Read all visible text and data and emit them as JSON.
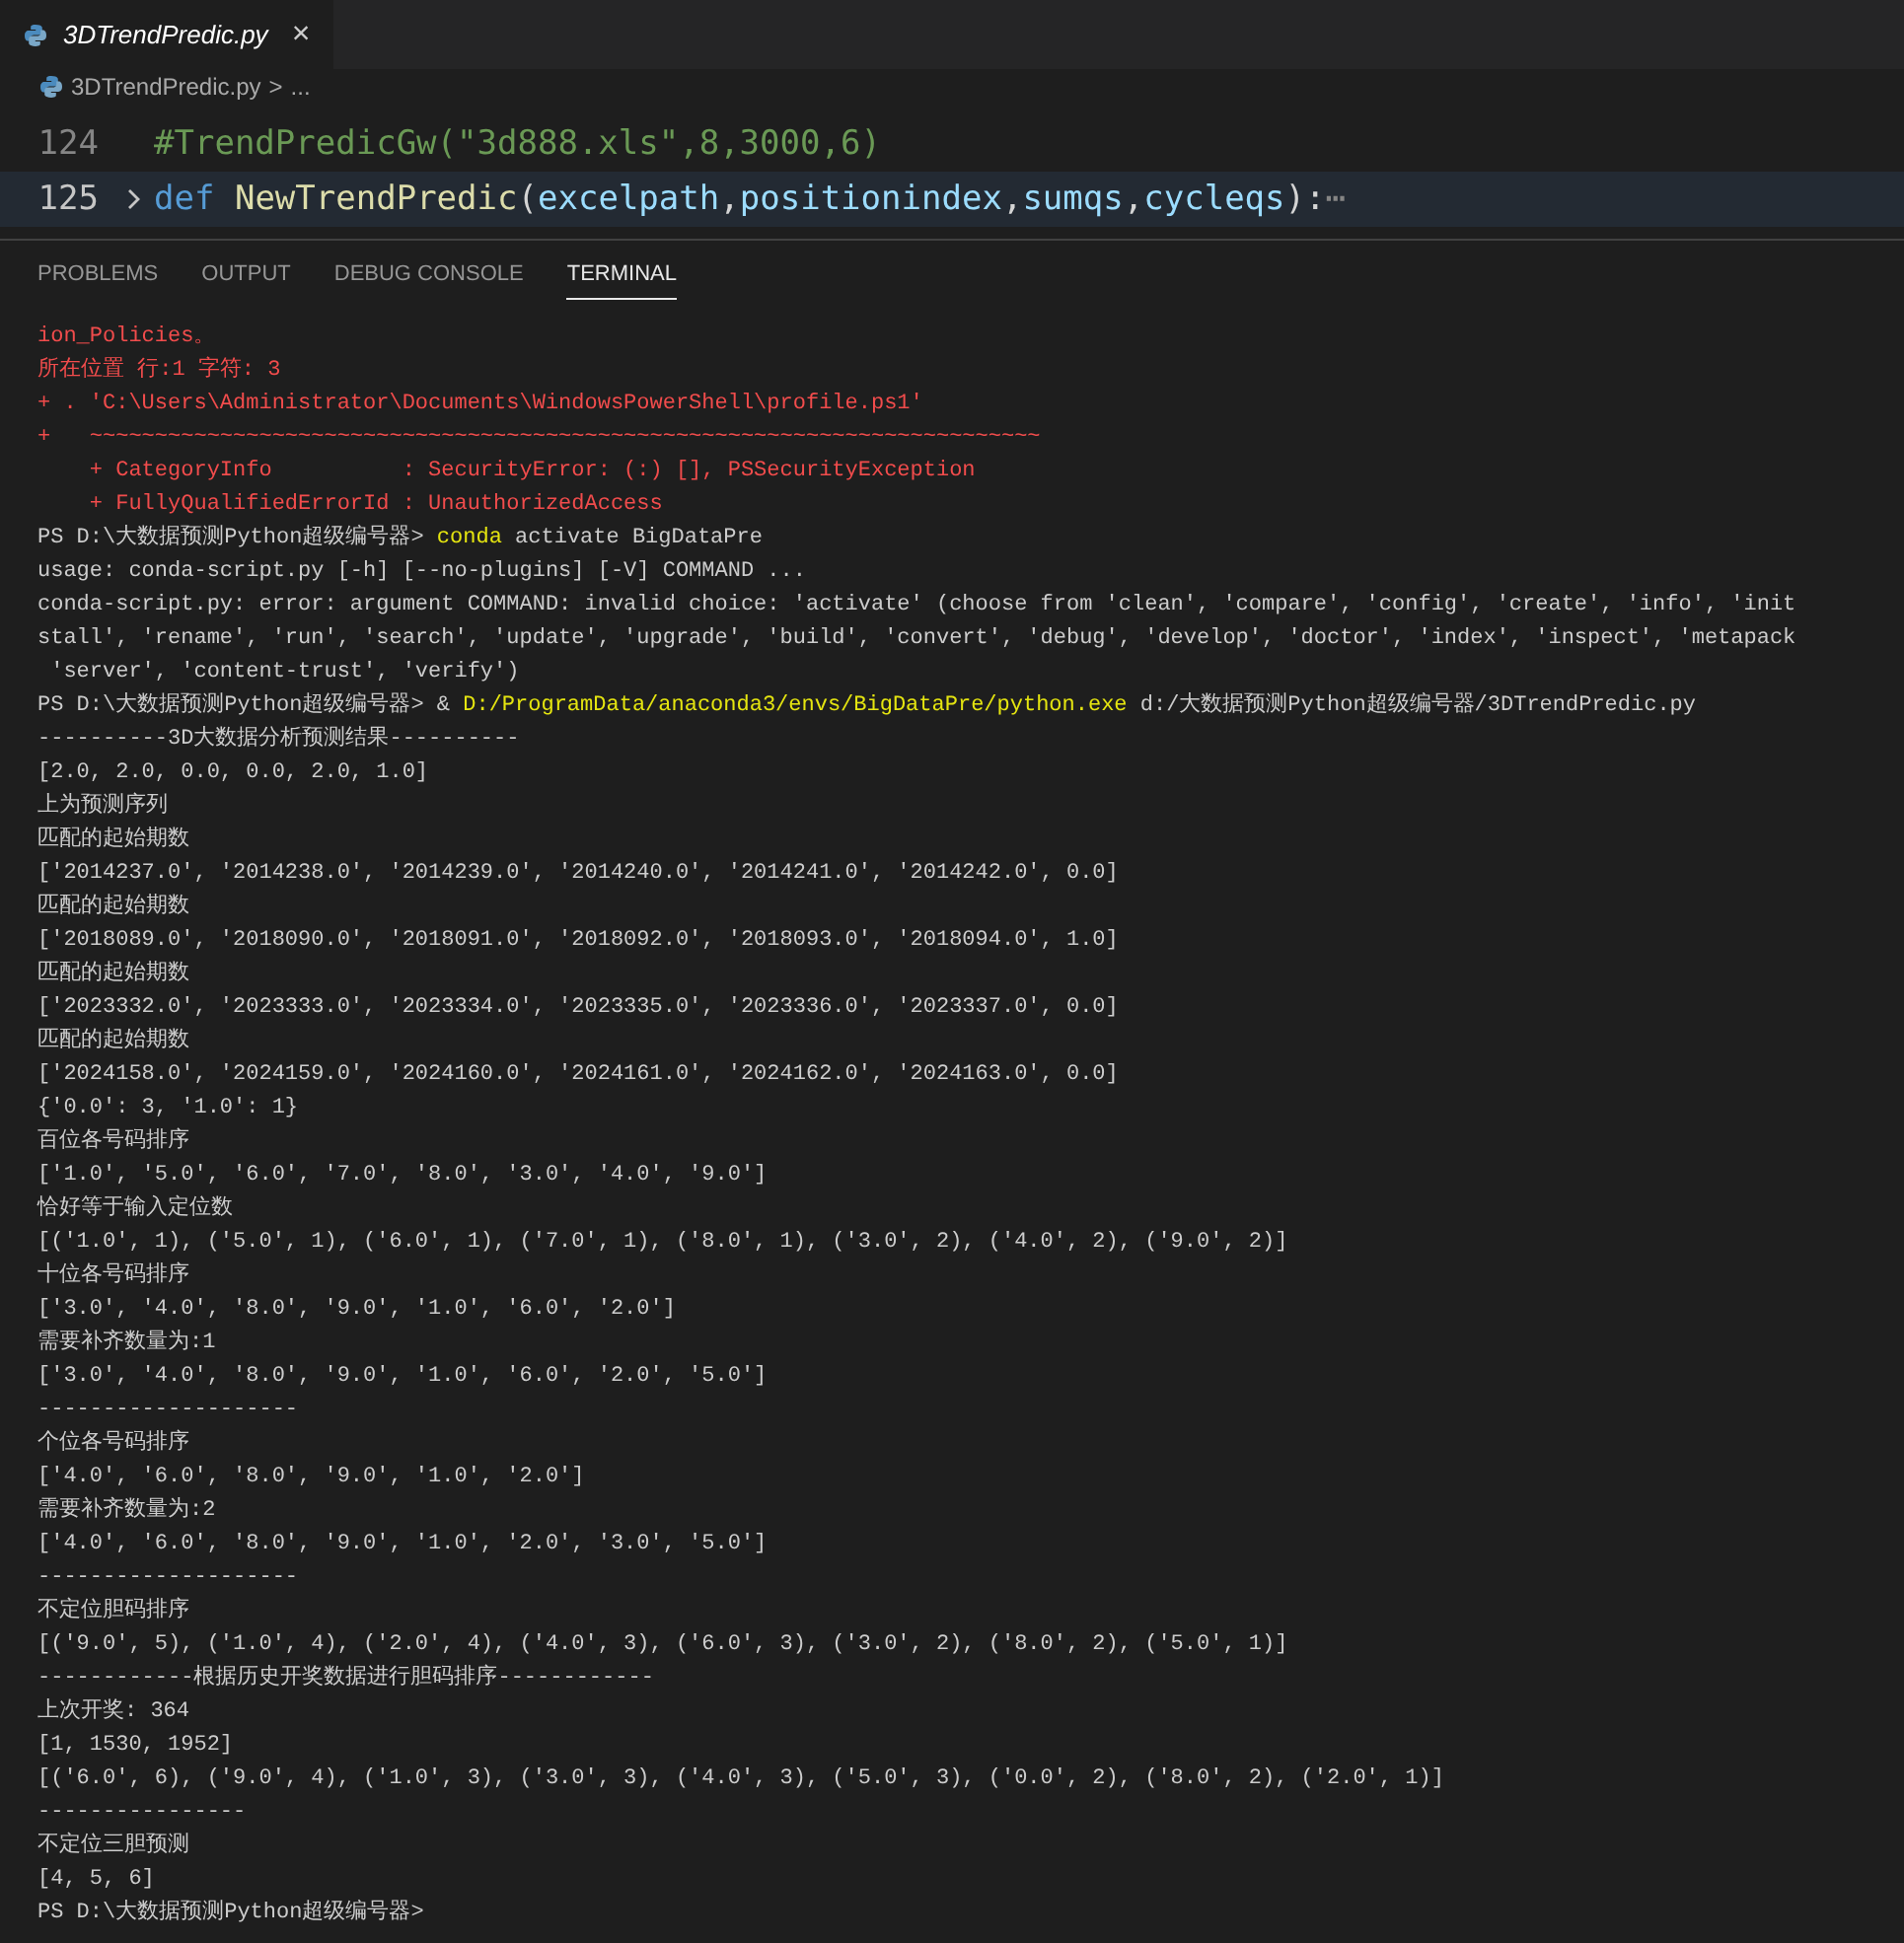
{
  "tabs": [
    {
      "label": "3DTrendPredic.py",
      "selected": true,
      "close": "×"
    }
  ],
  "breadcrumb": {
    "file": "3DTrendPredic.py",
    "separator": ">",
    "rest": "..."
  },
  "code_lines": [
    {
      "number": "124",
      "kind": "plain",
      "highlighted": false,
      "tokens": [
        {
          "kind": "comment",
          "text": "#TrendPredicGw(\"3d888.xls\",8,3000,6)"
        }
      ]
    },
    {
      "number": "125",
      "kind": "folded",
      "highlighted": true,
      "tokens": [
        {
          "kind": "keyword",
          "text": "def "
        },
        {
          "kind": "function",
          "text": "NewTrendPredic"
        },
        {
          "kind": "punct",
          "text": "("
        },
        {
          "kind": "param",
          "text": "excelpath"
        },
        {
          "kind": "punct",
          "text": ","
        },
        {
          "kind": "param",
          "text": "positionindex"
        },
        {
          "kind": "punct",
          "text": ","
        },
        {
          "kind": "param",
          "text": "sumqs"
        },
        {
          "kind": "punct",
          "text": ","
        },
        {
          "kind": "param",
          "text": "cycleqs"
        },
        {
          "kind": "punct",
          "text": "):"
        },
        {
          "kind": "ellipsis",
          "text": "⋯"
        }
      ]
    }
  ],
  "panel_tabs": [
    {
      "label": "PROBLEMS",
      "selected": false
    },
    {
      "label": "OUTPUT",
      "selected": false
    },
    {
      "label": "DEBUG CONSOLE",
      "selected": false
    },
    {
      "label": "TERMINAL",
      "selected": true
    }
  ],
  "terminal_lines": [
    [
      {
        "kind": "error",
        "text": "ion_Policies。"
      }
    ],
    [
      {
        "kind": "error",
        "text": "所在位置 行:1 字符: 3"
      }
    ],
    [
      {
        "kind": "error",
        "text": "+ . 'C:\\Users\\Administrator\\Documents\\WindowsPowerShell\\profile.ps1'"
      }
    ],
    [
      {
        "kind": "error",
        "text": "+   ~~~~~~~~~~~~~~~~~~~~~~~~~~~~~~~~~~~~~~~~~~~~~~~~~~~~~~~~~~~~~~~~~~~~~~~~~"
      }
    ],
    [
      {
        "kind": "error",
        "text": "    + CategoryInfo          : SecurityError: (:) [], PSSecurityException"
      }
    ],
    [
      {
        "kind": "error",
        "text": "    + FullyQualifiedErrorId : UnauthorizedAccess"
      }
    ],
    [
      {
        "kind": "plain",
        "text": "PS D:\\大数据预测Python超级编号器> "
      },
      {
        "kind": "command",
        "text": "conda"
      },
      {
        "kind": "plain",
        "text": " activate BigDataPre"
      }
    ],
    [
      {
        "kind": "plain",
        "text": "usage: conda-script.py [-h] [--no-plugins] [-V] COMMAND ..."
      }
    ],
    [
      {
        "kind": "plain",
        "text": "conda-script.py: error: argument COMMAND: invalid choice: 'activate' (choose from 'clean', 'compare', 'config', 'create', 'info', 'init"
      }
    ],
    [
      {
        "kind": "plain",
        "text": "stall', 'rename', 'run', 'search', 'update', 'upgrade', 'build', 'convert', 'debug', 'develop', 'doctor', 'index', 'inspect', 'metapack"
      }
    ],
    [
      {
        "kind": "plain",
        "text": " 'server', 'content-trust', 'verify')"
      }
    ],
    [
      {
        "kind": "plain",
        "text": "PS D:\\大数据预测Python超级编号器> & "
      },
      {
        "kind": "command",
        "text": "D:/ProgramData/anaconda3/envs/BigDataPre/python.exe"
      },
      {
        "kind": "plain",
        "text": " d:/大数据预测Python超级编号器/3DTrendPredic.py"
      }
    ],
    [
      {
        "kind": "plain",
        "text": "----------3D大数据分析预测结果----------"
      }
    ],
    [
      {
        "kind": "plain",
        "text": "[2.0, 2.0, 0.0, 0.0, 2.0, 1.0]"
      }
    ],
    [
      {
        "kind": "plain",
        "text": "上为预测序列"
      }
    ],
    [
      {
        "kind": "plain",
        "text": "匹配的起始期数"
      }
    ],
    [
      {
        "kind": "plain",
        "text": "['2014237.0', '2014238.0', '2014239.0', '2014240.0', '2014241.0', '2014242.0', 0.0]"
      }
    ],
    [
      {
        "kind": "plain",
        "text": "匹配的起始期数"
      }
    ],
    [
      {
        "kind": "plain",
        "text": "['2018089.0', '2018090.0', '2018091.0', '2018092.0', '2018093.0', '2018094.0', 1.0]"
      }
    ],
    [
      {
        "kind": "plain",
        "text": "匹配的起始期数"
      }
    ],
    [
      {
        "kind": "plain",
        "text": "['2023332.0', '2023333.0', '2023334.0', '2023335.0', '2023336.0', '2023337.0', 0.0]"
      }
    ],
    [
      {
        "kind": "plain",
        "text": "匹配的起始期数"
      }
    ],
    [
      {
        "kind": "plain",
        "text": "['2024158.0', '2024159.0', '2024160.0', '2024161.0', '2024162.0', '2024163.0', 0.0]"
      }
    ],
    [
      {
        "kind": "plain",
        "text": "{'0.0': 3, '1.0': 1}"
      }
    ],
    [
      {
        "kind": "plain",
        "text": "百位各号码排序"
      }
    ],
    [
      {
        "kind": "plain",
        "text": "['1.0', '5.0', '6.0', '7.0', '8.0', '3.0', '4.0', '9.0']"
      }
    ],
    [
      {
        "kind": "plain",
        "text": "恰好等于输入定位数"
      }
    ],
    [
      {
        "kind": "plain",
        "text": "[('1.0', 1), ('5.0', 1), ('6.0', 1), ('7.0', 1), ('8.0', 1), ('3.0', 2), ('4.0', 2), ('9.0', 2)]"
      }
    ],
    [
      {
        "kind": "plain",
        "text": "十位各号码排序"
      }
    ],
    [
      {
        "kind": "plain",
        "text": "['3.0', '4.0', '8.0', '9.0', '1.0', '6.0', '2.0']"
      }
    ],
    [
      {
        "kind": "plain",
        "text": "需要补齐数量为:1"
      }
    ],
    [
      {
        "kind": "plain",
        "text": "['3.0', '4.0', '8.0', '9.0', '1.0', '6.0', '2.0', '5.0']"
      }
    ],
    [
      {
        "kind": "plain",
        "text": "--------------------"
      }
    ],
    [
      {
        "kind": "plain",
        "text": "个位各号码排序"
      }
    ],
    [
      {
        "kind": "plain",
        "text": "['4.0', '6.0', '8.0', '9.0', '1.0', '2.0']"
      }
    ],
    [
      {
        "kind": "plain",
        "text": "需要补齐数量为:2"
      }
    ],
    [
      {
        "kind": "plain",
        "text": "['4.0', '6.0', '8.0', '9.0', '1.0', '2.0', '3.0', '5.0']"
      }
    ],
    [
      {
        "kind": "plain",
        "text": "--------------------"
      }
    ],
    [
      {
        "kind": "plain",
        "text": "不定位胆码排序"
      }
    ],
    [
      {
        "kind": "plain",
        "text": "[('9.0', 5), ('1.0', 4), ('2.0', 4), ('4.0', 3), ('6.0', 3), ('3.0', 2), ('8.0', 2), ('5.0', 1)]"
      }
    ],
    [
      {
        "kind": "plain",
        "text": "------------根据历史开奖数据进行胆码排序------------"
      }
    ],
    [
      {
        "kind": "plain",
        "text": "上次开奖: 364"
      }
    ],
    [
      {
        "kind": "plain",
        "text": "[1, 1530, 1952]"
      }
    ],
    [
      {
        "kind": "plain",
        "text": "[('6.0', 6), ('9.0', 4), ('1.0', 3), ('3.0', 3), ('4.0', 3), ('5.0', 3), ('0.0', 2), ('8.0', 2), ('2.0', 1)]"
      }
    ],
    [
      {
        "kind": "plain",
        "text": "----------------"
      }
    ],
    [
      {
        "kind": "plain",
        "text": "不定位三胆预测"
      }
    ],
    [
      {
        "kind": "plain",
        "text": "[4, 5, 6]"
      }
    ],
    [
      {
        "kind": "plain",
        "text": "PS D:\\大数据预测Python超级编号器>"
      }
    ]
  ]
}
